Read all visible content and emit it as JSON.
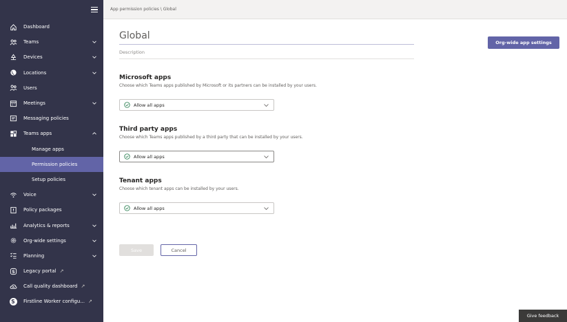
{
  "sidebar": {
    "items": [
      {
        "label": "Dashboard",
        "icon": "home-icon"
      },
      {
        "label": "Teams",
        "icon": "teams-icon",
        "expandable": true
      },
      {
        "label": "Devices",
        "icon": "devices-icon",
        "expandable": true
      },
      {
        "label": "Locations",
        "icon": "globe-icon",
        "expandable": true
      },
      {
        "label": "Users",
        "icon": "users-icon"
      },
      {
        "label": "Meetings",
        "icon": "calendar-icon",
        "expandable": true
      },
      {
        "label": "Messaging policies",
        "icon": "chat-icon"
      },
      {
        "label": "Teams apps",
        "icon": "apps-icon",
        "expanded": true
      },
      {
        "label": "Voice",
        "icon": "voice-icon",
        "expandable": true
      },
      {
        "label": "Policy packages",
        "icon": "package-icon"
      },
      {
        "label": "Analytics & reports",
        "icon": "analytics-icon",
        "expandable": true
      },
      {
        "label": "Org-wide settings",
        "icon": "gear-icon",
        "expandable": true
      },
      {
        "label": "Planning",
        "icon": "planning-icon",
        "expandable": true
      },
      {
        "label": "Legacy portal",
        "icon": "skype-icon",
        "external": true
      },
      {
        "label": "Call quality dashboard",
        "icon": "cloud-icon",
        "external": true
      },
      {
        "label": "Firstline Worker configu...",
        "icon": "firstline-icon",
        "external": true
      }
    ],
    "subitems": [
      {
        "label": "Manage apps"
      },
      {
        "label": "Permission policies",
        "active": true
      },
      {
        "label": "Setup policies"
      }
    ],
    "external_glyph": "↗"
  },
  "breadcrumb": "App permission policies \\ Global",
  "page": {
    "title": "Global",
    "description_placeholder": "Description",
    "org_button": "Org-wide app settings"
  },
  "sections": [
    {
      "title": "Microsoft apps",
      "description": "Choose which Teams apps published by Microsoft or its partners can be installed by your users.",
      "value": "Allow all apps"
    },
    {
      "title": "Third party apps",
      "description": "Choose which Teams apps published by a third party that can be installed by your users.",
      "value": "Allow all apps"
    },
    {
      "title": "Tenant apps",
      "description": "Choose which tenant apps can be installed by your users.",
      "value": "Allow all apps"
    }
  ],
  "actions": {
    "save": "Save",
    "cancel": "Cancel"
  },
  "feedback": "Give feedback",
  "colors": {
    "sidebar_bg": "#33344a",
    "accent": "#6264a7",
    "check": "#237b4b"
  }
}
